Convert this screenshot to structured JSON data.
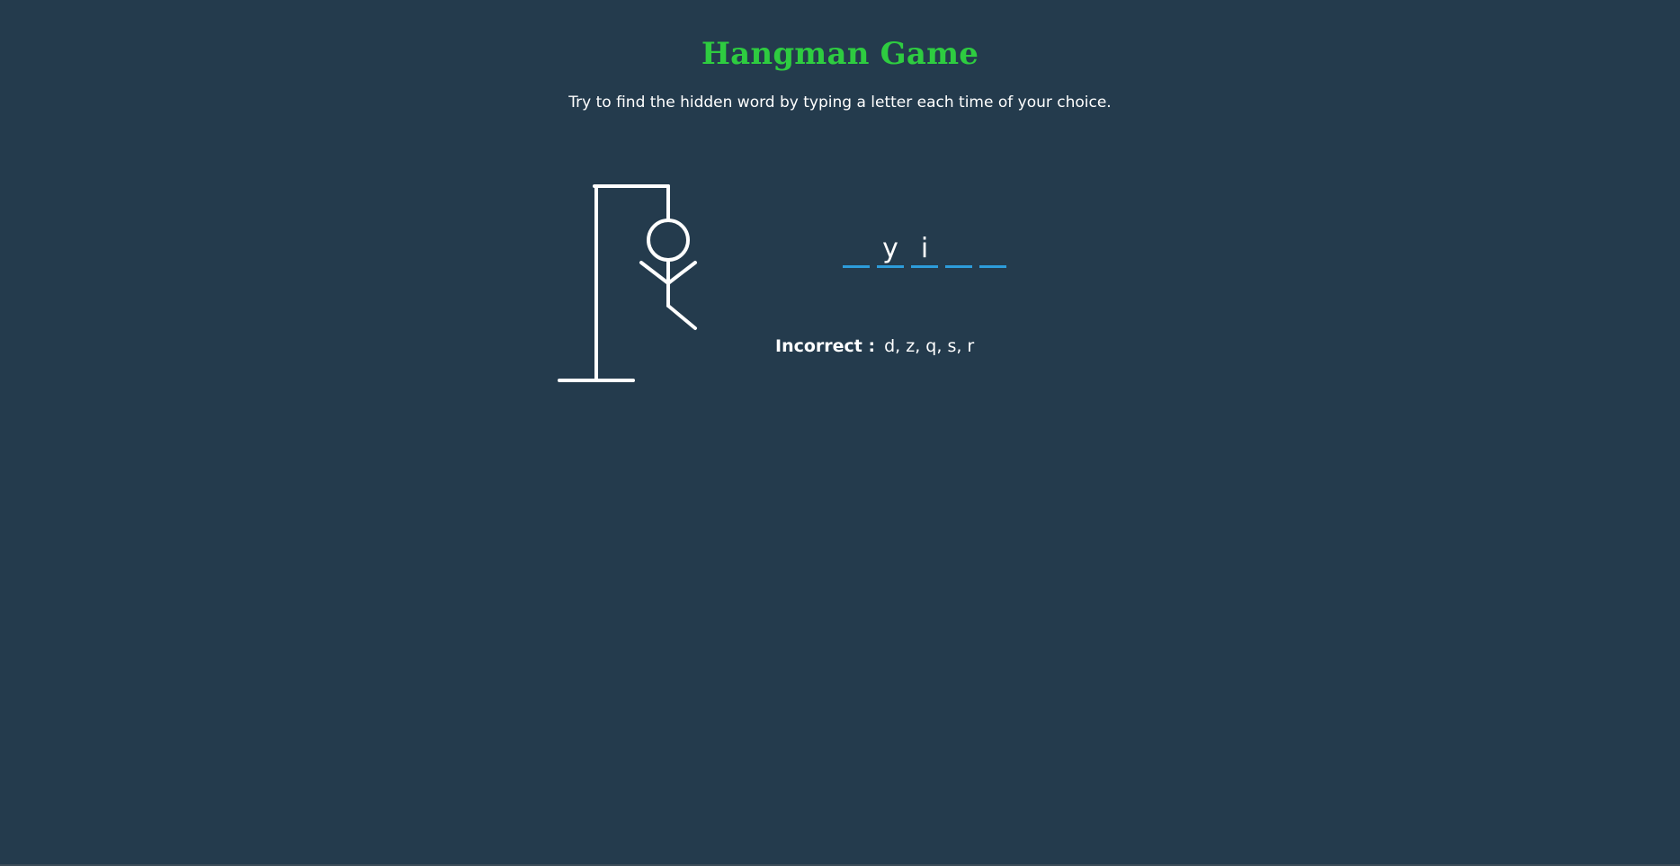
{
  "header": {
    "title": "Hangman Game",
    "subtitle": "Try to find the hidden word by typing a letter each time of your choice."
  },
  "word": {
    "slots": [
      "",
      "y",
      "i",
      "",
      "",
      ""
    ]
  },
  "incorrect": {
    "label": "Incorrect :",
    "letters": "d, z, q, s, r"
  },
  "colors": {
    "background": "#243b4d",
    "title": "#2ecc40",
    "slot_underline": "#2d9cdb",
    "text": "#ffffff"
  },
  "figure": {
    "drawing": "hangman-stick-figure",
    "parts_shown": [
      "gallows",
      "head",
      "body",
      "left-arm",
      "right-arm",
      "right-leg"
    ]
  }
}
